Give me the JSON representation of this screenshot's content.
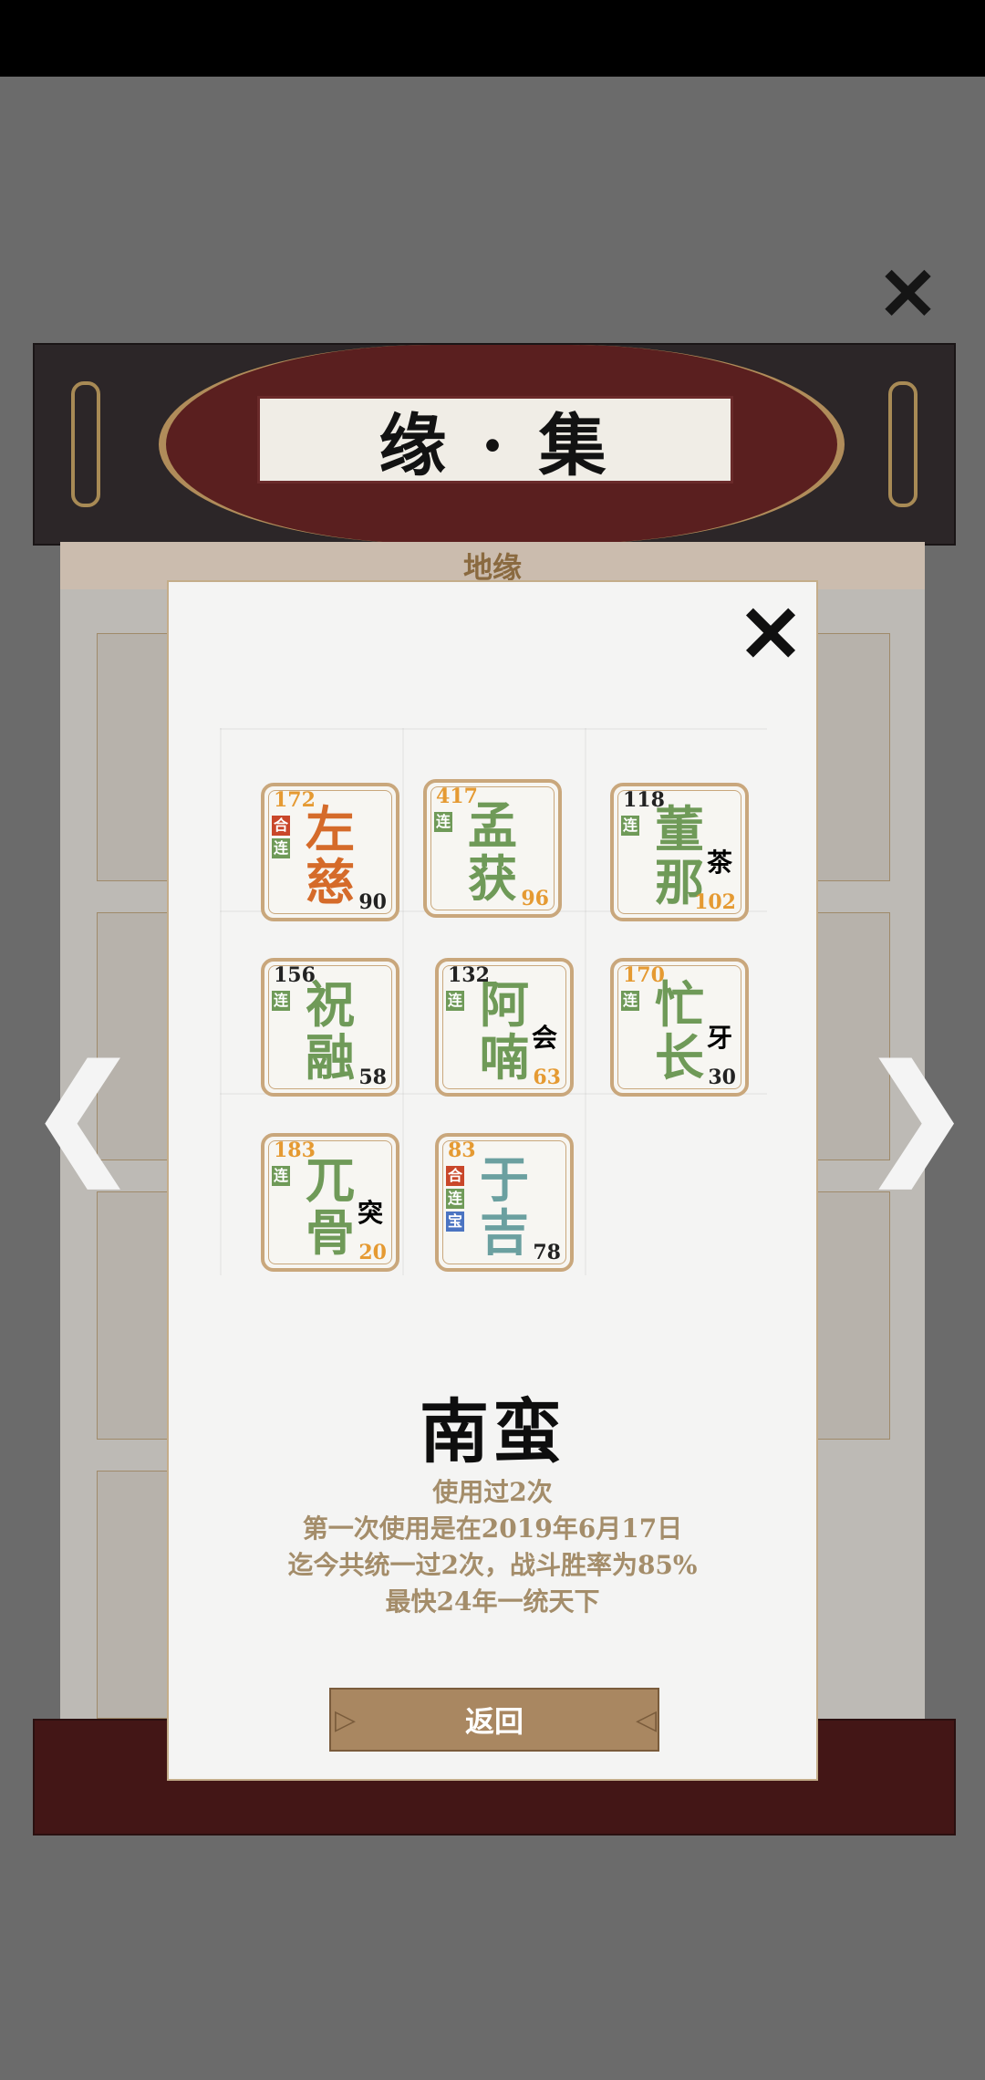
{
  "background": {
    "title": "缘 · 集",
    "tab": "地缘",
    "close_icon": "✕",
    "left_arrow_icon": "❮",
    "right_arrow_icon": "❯"
  },
  "modal": {
    "close_icon": "✕",
    "cards": [
      {
        "name_top": "左",
        "name_bottom": "慈",
        "num_top": "172",
        "num_bottom": "90",
        "tags": [
          "合",
          "连"
        ],
        "name_color": "orange",
        "num_top_color": "gold",
        "num_bottom_color": "dark",
        "sub": ""
      },
      {
        "name_top": "孟",
        "name_bottom": "获",
        "num_top": "417",
        "num_bottom": "96",
        "tags": [
          "连"
        ],
        "name_color": "green",
        "num_top_color": "gold",
        "num_bottom_color": "gold",
        "sub": ""
      },
      {
        "name_top": "董",
        "name_bottom": "那",
        "num_top": "118",
        "num_bottom": "102",
        "tags": [
          "连"
        ],
        "name_color": "green",
        "num_top_color": "dark",
        "num_bottom_color": "gold",
        "sub": "茶"
      },
      {
        "name_top": "祝",
        "name_bottom": "融",
        "num_top": "156",
        "num_bottom": "58",
        "tags": [
          "连"
        ],
        "name_color": "green",
        "num_top_color": "dark",
        "num_bottom_color": "dark",
        "sub": ""
      },
      {
        "name_top": "阿",
        "name_bottom": "喃",
        "num_top": "132",
        "num_bottom": "63",
        "tags": [
          "连"
        ],
        "name_color": "green",
        "num_top_color": "dark",
        "num_bottom_color": "gold",
        "sub": "会"
      },
      {
        "name_top": "忙",
        "name_bottom": "长",
        "num_top": "170",
        "num_bottom": "30",
        "tags": [
          "连"
        ],
        "name_color": "green",
        "num_top_color": "gold",
        "num_bottom_color": "dark",
        "sub": "牙"
      },
      {
        "name_top": "兀",
        "name_bottom": "骨",
        "num_top": "183",
        "num_bottom": "20",
        "tags": [
          "连"
        ],
        "name_color": "green",
        "num_top_color": "gold",
        "num_bottom_color": "gold",
        "sub": "突"
      },
      {
        "name_top": "于",
        "name_bottom": "吉",
        "num_top": "83",
        "num_bottom": "78",
        "tags": [
          "合",
          "连",
          "宝"
        ],
        "name_color": "teal",
        "num_top_color": "gold",
        "num_bottom_color": "dark",
        "sub": ""
      }
    ],
    "faction": "南蛮",
    "stats": [
      "使用过2次",
      "第一次使用是在2019年6月17日",
      "迄今共统一过2次，战斗胜率为85%",
      "最快24年一统天下"
    ],
    "back_label": "返回"
  },
  "colors": {
    "orange": "#d56b2a",
    "green": "#6f9a58",
    "teal": "#6ba0a0",
    "gold": "#e59a32",
    "dark": "#222222",
    "card_border": "#c9a77c",
    "button_bg": "#a98761"
  }
}
